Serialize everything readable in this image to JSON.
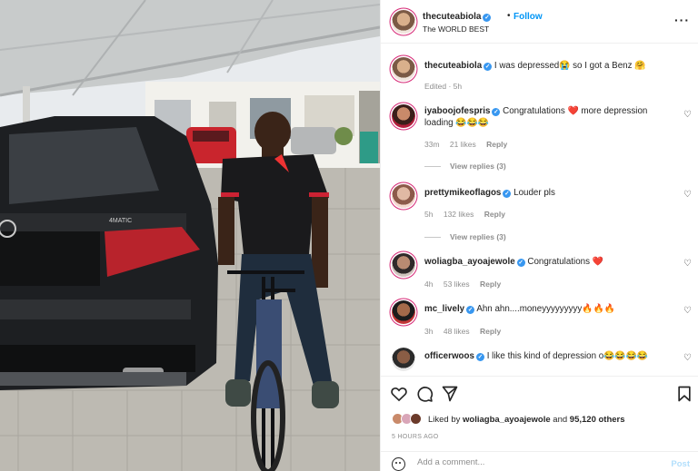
{
  "header": {
    "username": "thecuteabiola",
    "subtitle": "The WORLD BEST",
    "separator": "•",
    "follow_label": "Follow",
    "more_icon": "more-horizontal-icon"
  },
  "caption": {
    "username": "thecuteabiola",
    "text": "I was depressed😭 so I got a Benz 🤗",
    "meta": "Edited · 5h"
  },
  "comments": [
    {
      "username": "iyaboojofespris",
      "text": "Congratulations ❤️ more depression loading 😂😂😂",
      "time": "33m",
      "likes": "21 likes",
      "reply": "Reply",
      "view_replies": "View replies (3)"
    },
    {
      "username": "prettymikeoflagos",
      "text": "Louder pls",
      "time": "5h",
      "likes": "132 likes",
      "reply": "Reply",
      "view_replies": "View replies (3)"
    },
    {
      "username": "woliagba_ayoajewole",
      "text": "Congratulations ❤️",
      "time": "4h",
      "likes": "53 likes",
      "reply": "Reply"
    },
    {
      "username": "mc_lively",
      "text": "Ahn ahn....moneyyyyyyyyy🔥🔥🔥",
      "time": "3h",
      "likes": "48 likes",
      "reply": "Reply"
    },
    {
      "username": "officerwoos",
      "text": "I like this kind of depression o😂😂😂😂"
    }
  ],
  "actions": {
    "like_icon": "heart-icon",
    "comment_icon": "comment-icon",
    "share_icon": "share-icon",
    "save_icon": "bookmark-icon"
  },
  "likes": {
    "prefix": "Liked by ",
    "user": "woliagba_ayoajewole",
    "middle": " and ",
    "others": "95,120 others"
  },
  "time_ago": "5 HOURS AGO",
  "comment_box": {
    "placeholder": "Add a comment...",
    "post_label": "Post"
  },
  "colors": {
    "accent": "#0095f6",
    "verified": "#3897f0",
    "heart_red": "#ed4956",
    "muted_text": "#8e8e8e"
  }
}
